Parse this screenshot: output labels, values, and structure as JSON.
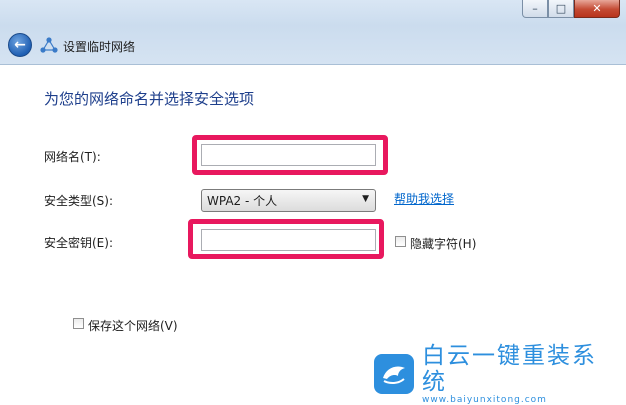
{
  "window": {
    "minimize_glyph": "–",
    "maximize_glyph": "□",
    "close_glyph": "✕"
  },
  "nav": {
    "back_icon": "back-arrow-icon",
    "network_icon": "network-icon",
    "title": "设置临时网络"
  },
  "main": {
    "heading": "为您的网络命名并选择安全选项",
    "network_name_label": "网络名(T):",
    "network_name_value": "",
    "security_type_label": "安全类型(S):",
    "security_type_value": "WPA2 - 个人",
    "help_link": "帮助我选择",
    "security_key_label": "安全密钥(E):",
    "security_key_value": "",
    "hide_chars_label": "隐藏字符(H)",
    "save_network_label": "保存这个网络(V)"
  },
  "colors": {
    "highlight": "#e8185e",
    "heading": "#1e3f8c",
    "link": "#0066cc"
  },
  "watermark": {
    "title": "白云一键重装系统",
    "url": "www.baiyunxitong.com"
  }
}
